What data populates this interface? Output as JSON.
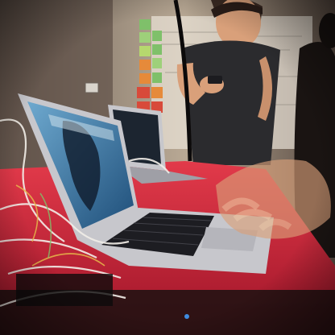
{
  "scene": {
    "colors": {
      "wall": "#9a8a78",
      "wall_shadow": "#3a2d26",
      "table_red": "#c8203a",
      "table_highlight": "#e23a4a",
      "laptop_silver": "#c7c7cc",
      "laptop_dark": "#2a2a30",
      "screen_blue": "#3f7fb0",
      "skin": "#d9a07a",
      "shirt": "#2b2b2e",
      "sticky_green": "#7fc06a",
      "sticky_orange": "#e68a3a",
      "sticky_red": "#d84a3a",
      "cable_white": "#f2eee8"
    },
    "icons": [
      "laptop-icon",
      "phone-icon",
      "sticky-note-icon",
      "cable-icon",
      "hand-icon"
    ]
  }
}
